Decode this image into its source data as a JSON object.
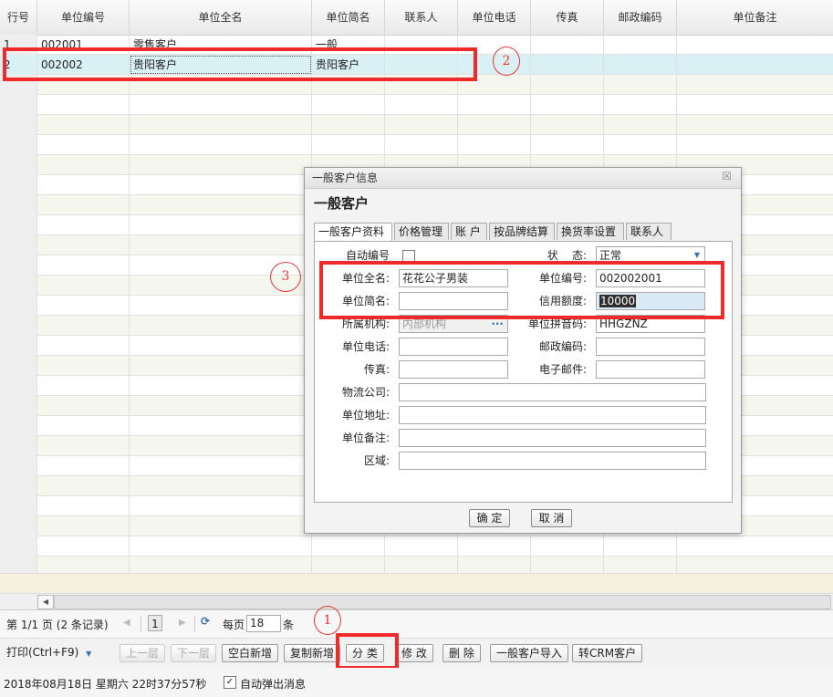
{
  "grid": {
    "columns": [
      "行号",
      "单位编号",
      "单位全名",
      "单位简名",
      "联系人",
      "单位电话",
      "传真",
      "邮政编码",
      "单位备注"
    ],
    "rows": [
      {
        "no": "1",
        "code": "002001",
        "fullname": "零售客户",
        "shortname": "一般"
      },
      {
        "no": "2",
        "code": "002002",
        "fullname": "贵阳客户",
        "shortname": "贵阳客户"
      }
    ]
  },
  "annotations": {
    "one": "1",
    "two": "2",
    "three": "3"
  },
  "dialog": {
    "window_title": "一般客户信息",
    "close": "☒",
    "heading": "一般客户",
    "tabs": [
      "一般客户资料",
      "价格管理",
      "账 户",
      "按品牌结算",
      "换货率设置",
      "联系人"
    ],
    "form": {
      "auto_number_label": "自动编号",
      "status_label": "状    态:",
      "status_value": "正常",
      "fullname_label": "单位全名:",
      "fullname_value": "花花公子男装",
      "code_label": "单位编号:",
      "code_value": "002002001",
      "shortname_label": "单位简名:",
      "shortname_value": "",
      "credit_label": "信用额度:",
      "credit_value": "10000",
      "org_label": "所属机构:",
      "org_value": "内部机构",
      "org_more": "···",
      "pinyin_label": "单位拼音码:",
      "pinyin_value": "HHGZNZ",
      "phone_label": "单位电话:",
      "postcode_label": "邮政编码:",
      "fax_label": "传真:",
      "email_label": "电子邮件:",
      "logistics_label": "物流公司:",
      "address_label": "单位地址:",
      "remark_label": "单位备注:",
      "region_label": "区域:"
    },
    "ok": "确 定",
    "cancel": "取 消"
  },
  "pager": {
    "info": "第 1/1 页 (2 条记录)",
    "first": "◀",
    "page": "1",
    "next": "▶",
    "refresh": "⟳",
    "per_page_label": "每页",
    "per_page": "18",
    "unit": "条"
  },
  "toolbar": {
    "print": "打印(Ctrl+F9)",
    "prev_level": "上一层",
    "next_level": "下一层",
    "blank_add": "空白新增",
    "copy_add": "复制新增",
    "classify": "分 类",
    "edit": "修 改",
    "delete": "删 除",
    "import": "一般客户导入",
    "to_crm": "转CRM客户"
  },
  "status": {
    "datetime": "2018年08月18日 星期六 22时37分57秒",
    "auto_popup": "自动弹出消息"
  }
}
